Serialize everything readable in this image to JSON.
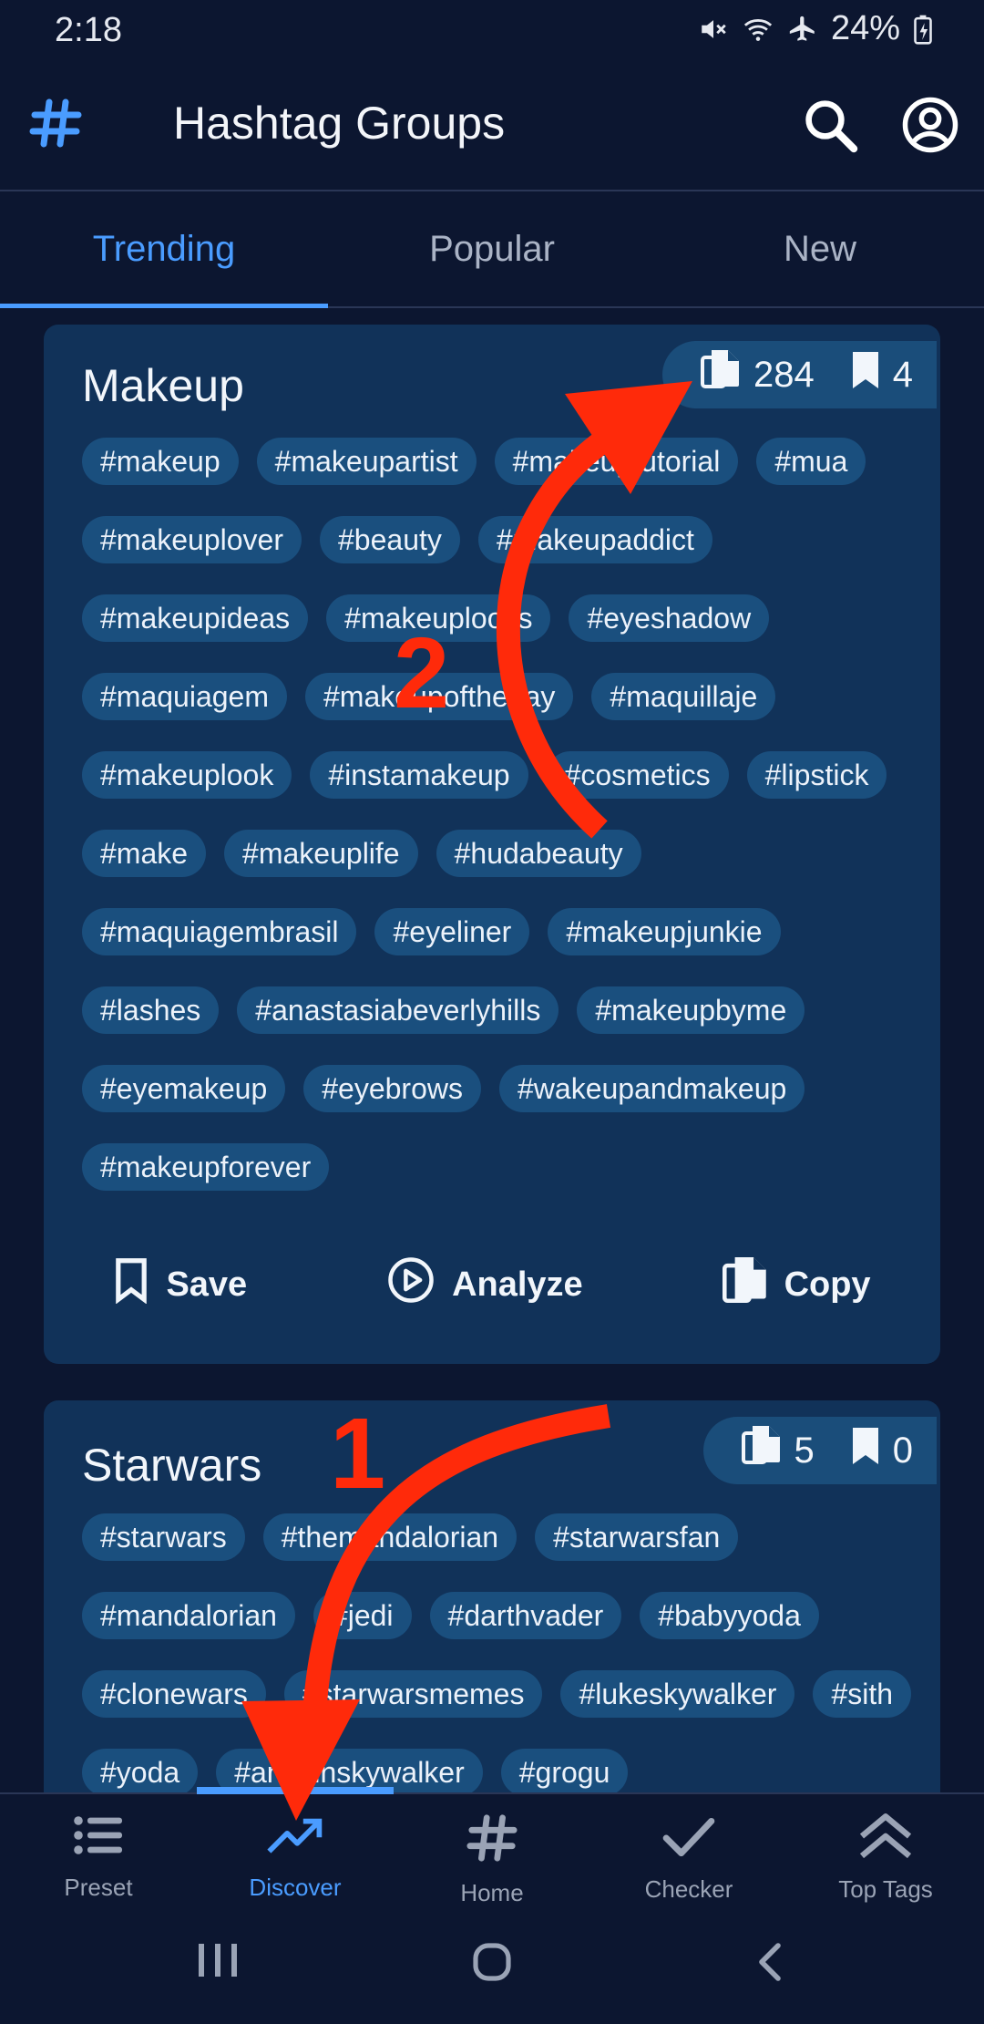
{
  "status_bar": {
    "time": "2:18",
    "battery": "24%"
  },
  "app_bar": {
    "title": "Hashtag Groups"
  },
  "tabs": [
    {
      "label": "Trending",
      "active": true
    },
    {
      "label": "Popular",
      "active": false
    },
    {
      "label": "New",
      "active": false
    }
  ],
  "cards": [
    {
      "title": "Makeup",
      "copy_count": "284",
      "save_count": "4",
      "tags": [
        "#makeup",
        "#makeupartist",
        "#makeuptutorial",
        "#mua",
        "#makeuplover",
        "#beauty",
        "#makeupaddict",
        "#makeupideas",
        "#makeuplooks",
        "#eyeshadow",
        "#maquiagem",
        "#makeupoftheday",
        "#maquillaje",
        "#makeuplook",
        "#instamakeup",
        "#cosmetics",
        "#lipstick",
        "#make",
        "#makeuplife",
        "#hudabeauty",
        "#maquiagembrasil",
        "#eyeliner",
        "#makeupjunkie",
        "#lashes",
        "#anastasiabeverlyhills",
        "#makeupbyme",
        "#eyemakeup",
        "#eyebrows",
        "#wakeupandmakeup",
        "#makeupforever"
      ],
      "actions": {
        "save": "Save",
        "analyze": "Analyze",
        "copy": "Copy"
      }
    },
    {
      "title": "Starwars",
      "copy_count": "5",
      "save_count": "0",
      "tags": [
        "#starwars",
        "#themandalorian",
        "#starwarsfan",
        "#mandalorian",
        "#jedi",
        "#darthvader",
        "#babyyoda",
        "#clonewars",
        "#starwarsmemes",
        "#lukeskywalker",
        "#sith",
        "#yoda",
        "#anakinskywalker",
        "#grogu"
      ]
    }
  ],
  "annotations": {
    "step1": "1",
    "step2": "2",
    "arrow_color": "#ff2a0a"
  },
  "bottom_nav": [
    {
      "label": "Preset",
      "icon": "list-icon",
      "active": false
    },
    {
      "label": "Discover",
      "icon": "trending-up-icon",
      "active": true
    },
    {
      "label": "Home",
      "icon": "hashtag-icon",
      "active": false
    },
    {
      "label": "Checker",
      "icon": "check-icon",
      "active": false
    },
    {
      "label": "Top Tags",
      "icon": "double-chevron-up-icon",
      "active": false
    }
  ],
  "colors": {
    "background": "#0c1630",
    "card": "#113259",
    "tag": "#1a4f7e",
    "accent": "#4a9cff"
  }
}
